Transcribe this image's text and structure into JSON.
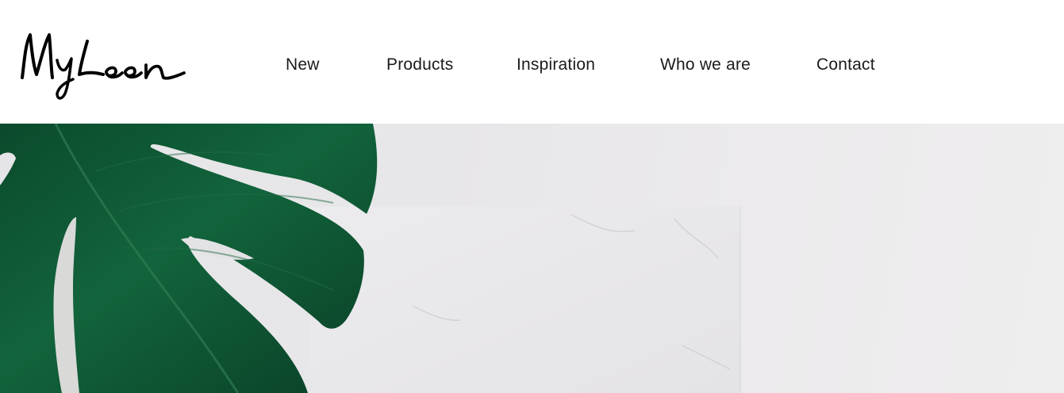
{
  "brand": {
    "logo_text": "MyLeen"
  },
  "nav": {
    "items": [
      {
        "label": "New"
      },
      {
        "label": "Products"
      },
      {
        "label": "Inspiration"
      },
      {
        "label": "Who we are"
      },
      {
        "label": "Contact"
      }
    ]
  },
  "hero": {
    "image": "monstera-leaf-on-marble",
    "colors": {
      "leaf": "#0f5a36",
      "marble": "#e7e6e9"
    }
  }
}
